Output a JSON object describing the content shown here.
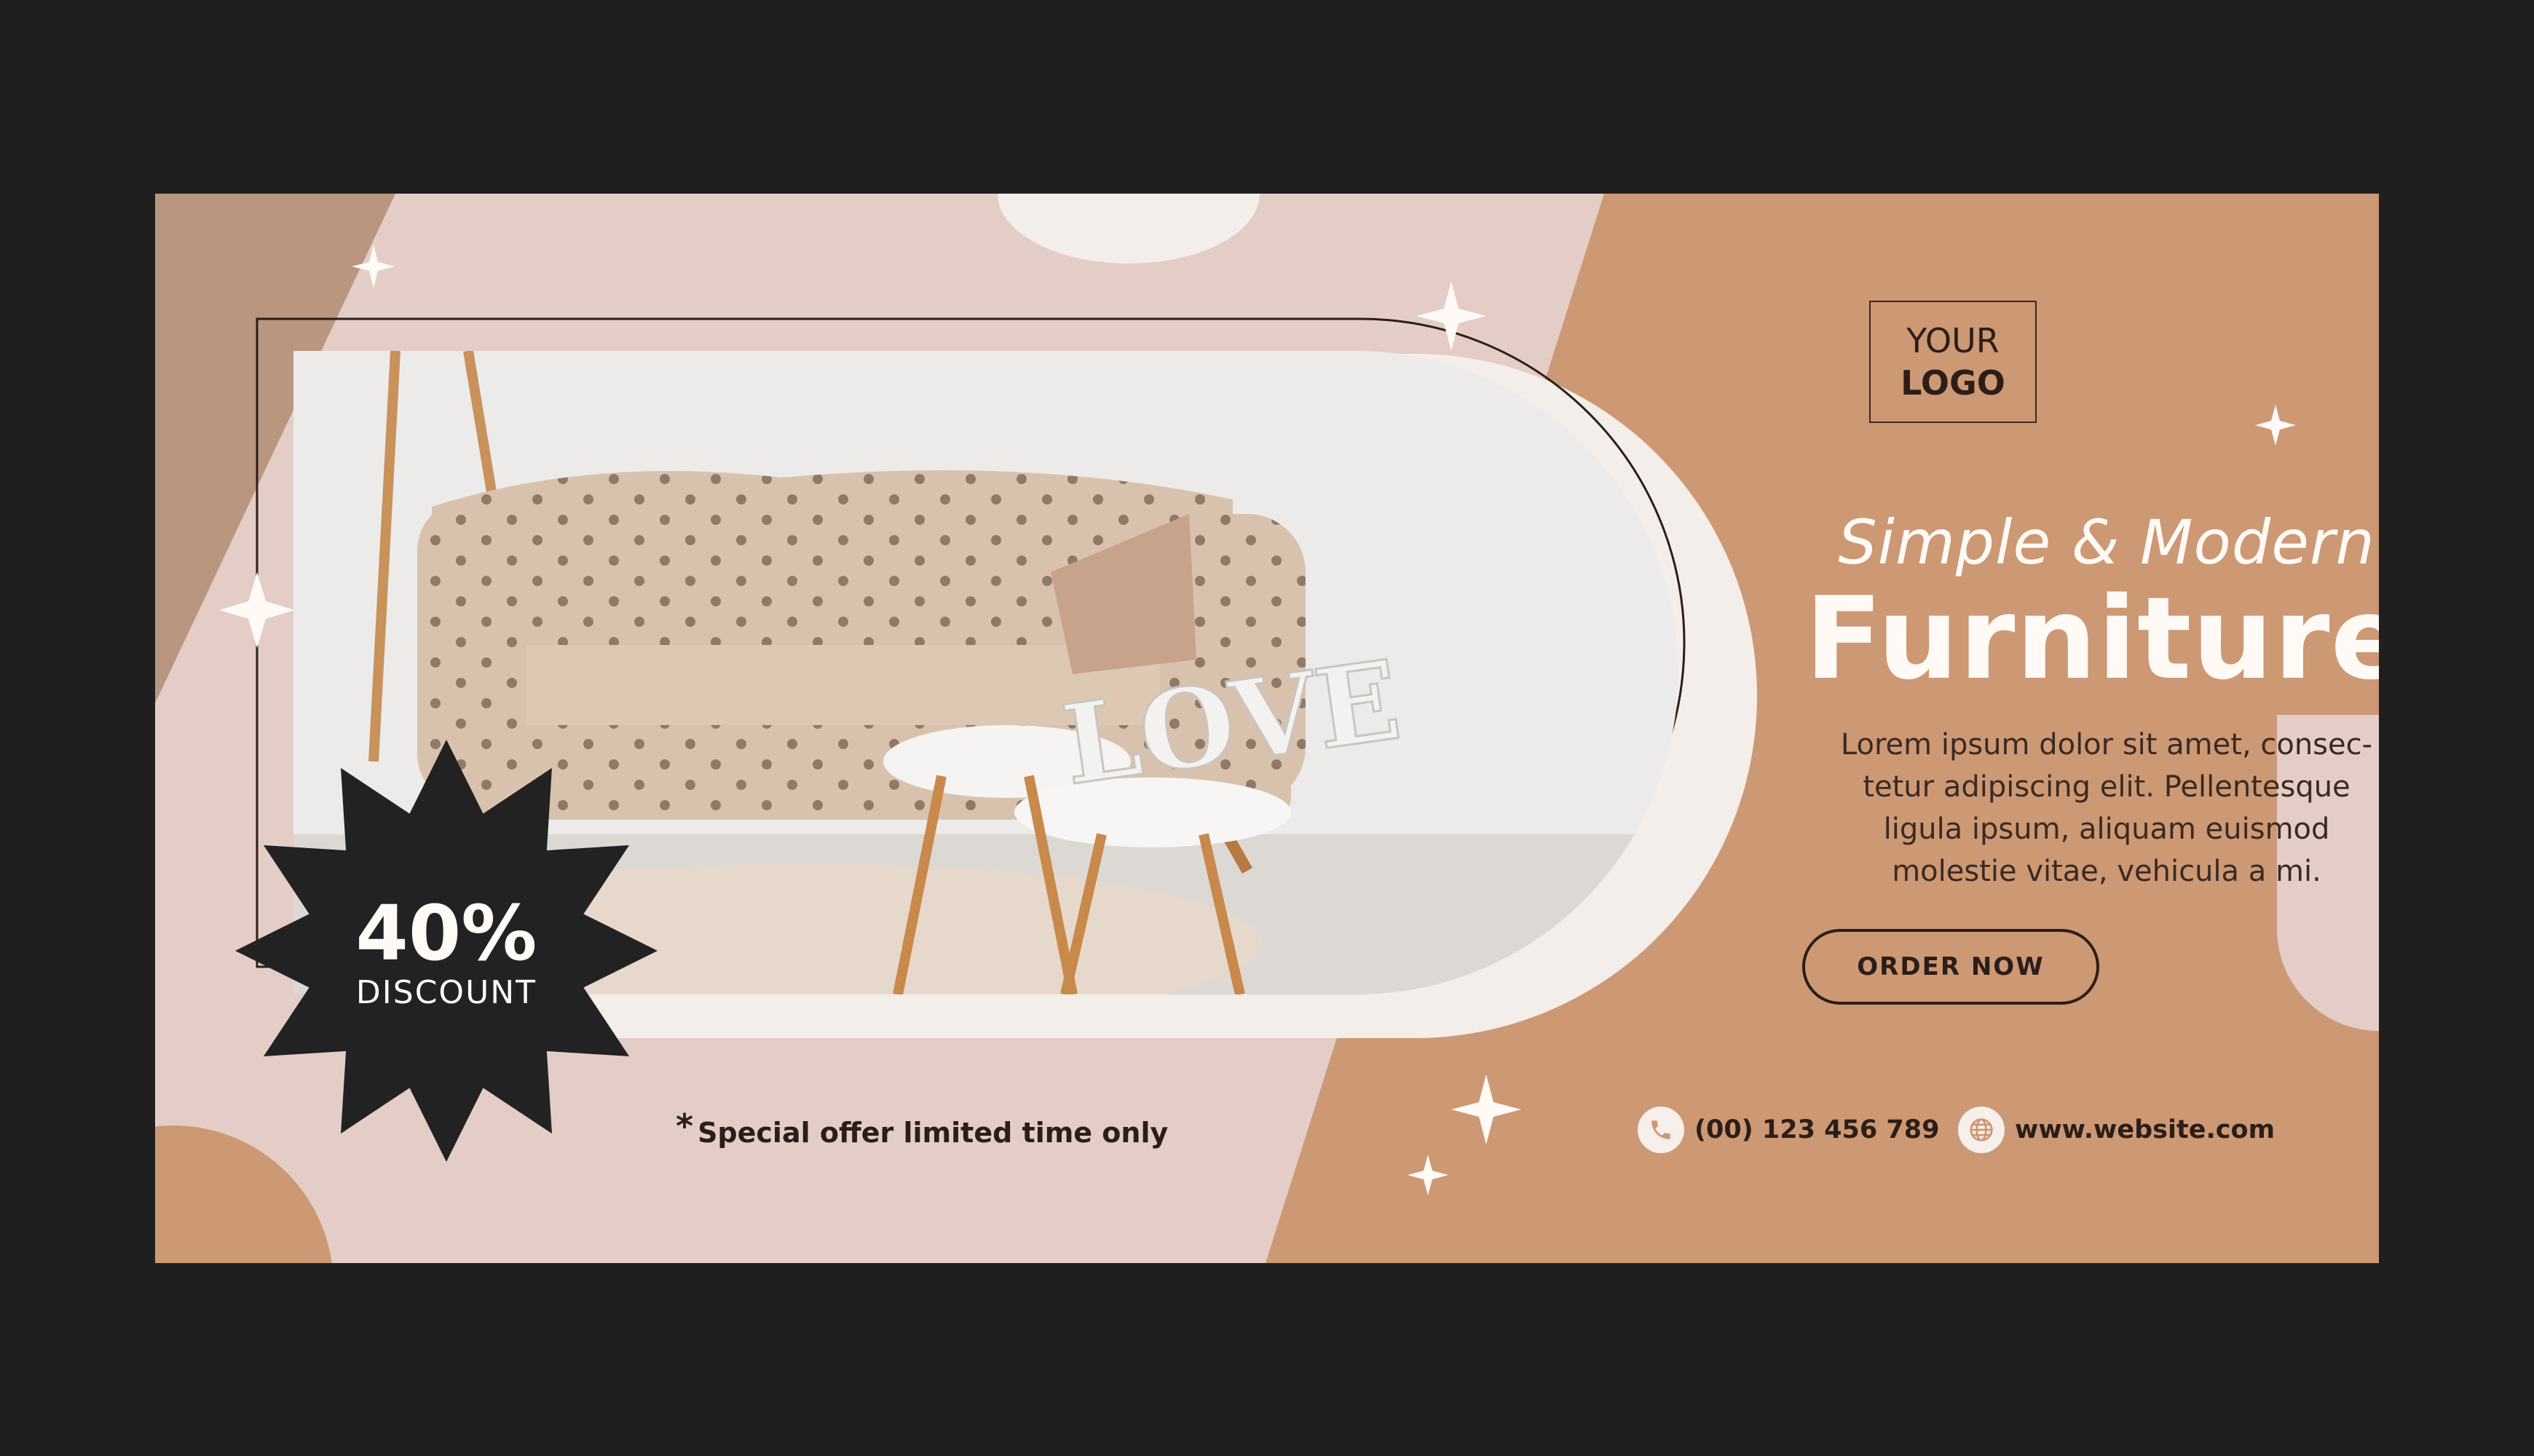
{
  "colors": {
    "background": "#1f1f1f",
    "banner_pink": "#e3cdc6",
    "banner_tan": "#cd9874",
    "accent_dark": "#2b1e18",
    "cream": "#f4eeea"
  },
  "logo": {
    "line1": "YOUR",
    "line2": "LOGO"
  },
  "headline": {
    "line1": "Simple & Modern",
    "line2": "Furniture"
  },
  "body_copy": [
    "Lorem ipsum dolor sit amet, consec-",
    "tetur adipiscing elit. Pellentesque",
    "ligula ipsum, aliquam euismod",
    "molestie vitae, vehicula a mi."
  ],
  "cta": {
    "label": "ORDER NOW"
  },
  "discount": {
    "percent": "40%",
    "label": "DISCOUNT"
  },
  "offer_note": {
    "asterisk": "*",
    "text": "Special offer limited time only"
  },
  "contact": {
    "phone": "(00) 123 456 789",
    "phone_icon": "phone-icon",
    "website": "www.website.com",
    "website_icon": "globe-icon"
  },
  "photo": {
    "subject": "tufted beige sofa with two side tables",
    "sign_text": "LOVE"
  }
}
